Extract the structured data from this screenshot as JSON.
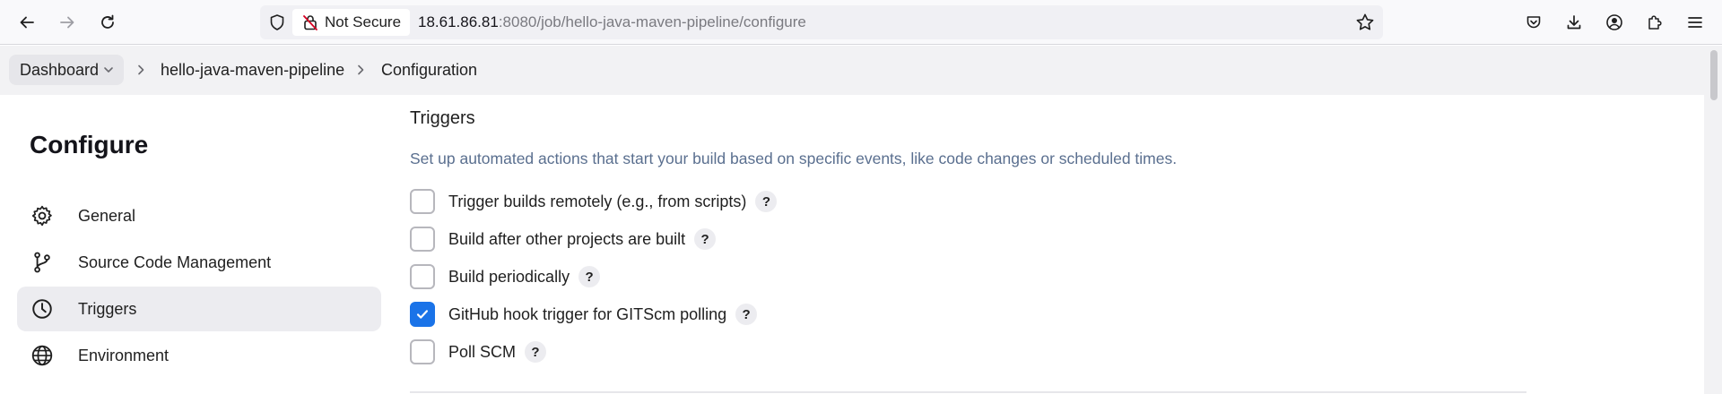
{
  "browser": {
    "security_label": "Not Secure",
    "url_host": "18.61.86.81",
    "url_rest": ":8080/job/hello-java-maven-pipeline/configure"
  },
  "breadcrumbs": {
    "dashboard": "Dashboard",
    "job": "hello-java-maven-pipeline",
    "page": "Configuration"
  },
  "sidebar": {
    "title": "Configure",
    "items": [
      {
        "label": "General",
        "icon": "gear-icon",
        "active": false
      },
      {
        "label": "Source Code Management",
        "icon": "branch-icon",
        "active": false
      },
      {
        "label": "Triggers",
        "icon": "clock-icon",
        "active": true
      },
      {
        "label": "Environment",
        "icon": "globe-icon",
        "active": false
      }
    ]
  },
  "triggers": {
    "title": "Triggers",
    "description": "Set up automated actions that start your build based on specific events, like code changes or scheduled times.",
    "help_glyph": "?",
    "options": [
      {
        "label": "Trigger builds remotely (e.g., from scripts)",
        "checked": false
      },
      {
        "label": "Build after other projects are built",
        "checked": false
      },
      {
        "label": "Build periodically",
        "checked": false
      },
      {
        "label": "GitHub hook trigger for GITScm polling",
        "checked": true
      },
      {
        "label": "Poll SCM",
        "checked": false
      }
    ]
  },
  "colors": {
    "accent": "#1a73e8",
    "description_text": "#5a6f8f",
    "active_nav_bg": "#ececf0"
  }
}
